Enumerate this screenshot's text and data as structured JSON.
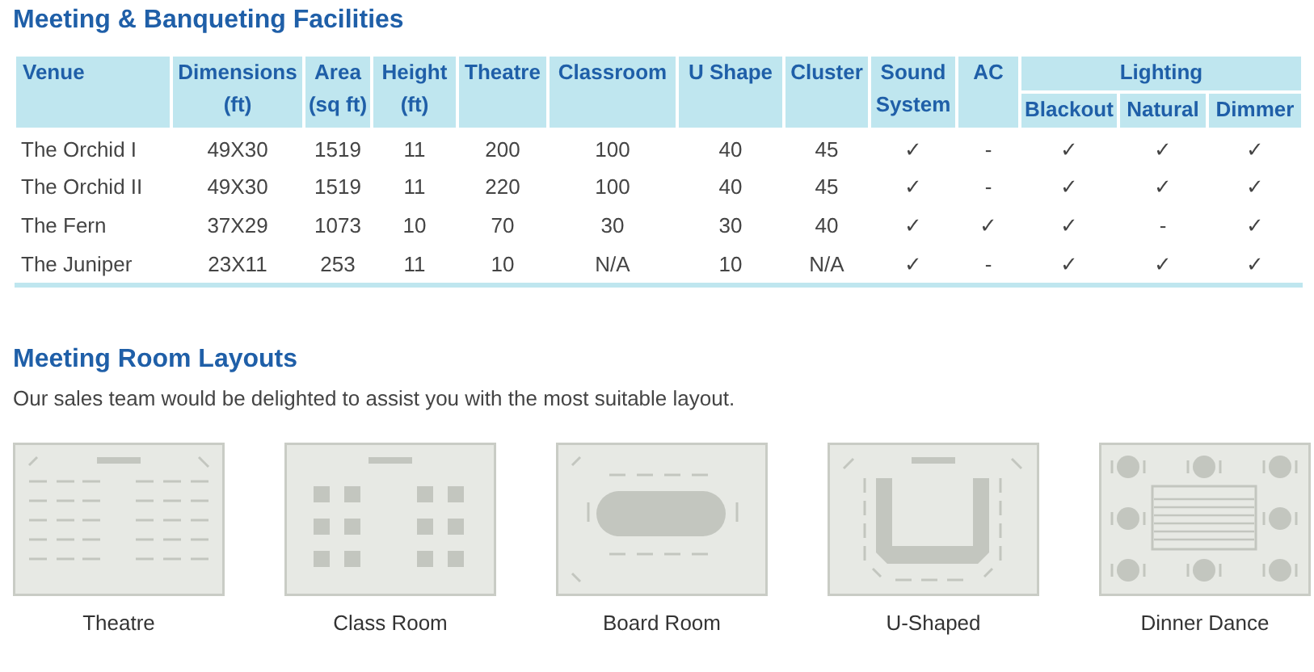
{
  "facilities": {
    "title": "Meeting & Banqueting Facilities",
    "columns": [
      {
        "label": "Venue"
      },
      {
        "label": "Dimensions (ft)"
      },
      {
        "label": "Area (sq ft)"
      },
      {
        "label": "Height (ft)"
      },
      {
        "label": "Theatre"
      },
      {
        "label": "Classroom"
      },
      {
        "label": "U Shape"
      },
      {
        "label": "Cluster"
      },
      {
        "label": "Sound System"
      },
      {
        "label": "AC"
      },
      {
        "label": "Blackout"
      },
      {
        "label": "Natural"
      },
      {
        "label": "Dimmer"
      }
    ],
    "column_groups": [
      {
        "label": "Lighting",
        "colspan": 3
      }
    ],
    "rows": [
      [
        "The Orchid I",
        "49X30",
        "1519",
        "11",
        "200",
        "100",
        "40",
        "45",
        "✓",
        "-",
        "✓",
        "✓",
        "✓"
      ],
      [
        "The Orchid II",
        "49X30",
        "1519",
        "11",
        "220",
        "100",
        "40",
        "45",
        "✓",
        "-",
        "✓",
        "✓",
        "✓"
      ],
      [
        "The Fern",
        "37X29",
        "1073",
        "10",
        "70",
        "30",
        "30",
        "40",
        "✓",
        "✓",
        "✓",
        "-",
        "✓"
      ],
      [
        "The Juniper",
        "23X11",
        "253",
        "11",
        "10",
        "N/A",
        "10",
        "N/A",
        "✓",
        "-",
        "✓",
        "✓",
        "✓"
      ]
    ]
  },
  "layouts": {
    "title": "Meeting Room Layouts",
    "intro": "Our sales team would be delighted to assist you with the most suitable layout.",
    "items": [
      {
        "kind": "theatre",
        "label": "Theatre"
      },
      {
        "kind": "classroom",
        "label": "Class Room"
      },
      {
        "kind": "boardroom",
        "label": "Board Room"
      },
      {
        "kind": "ushape",
        "label": "U-Shaped"
      },
      {
        "kind": "dinner",
        "label": "Dinner Dance"
      }
    ]
  }
}
